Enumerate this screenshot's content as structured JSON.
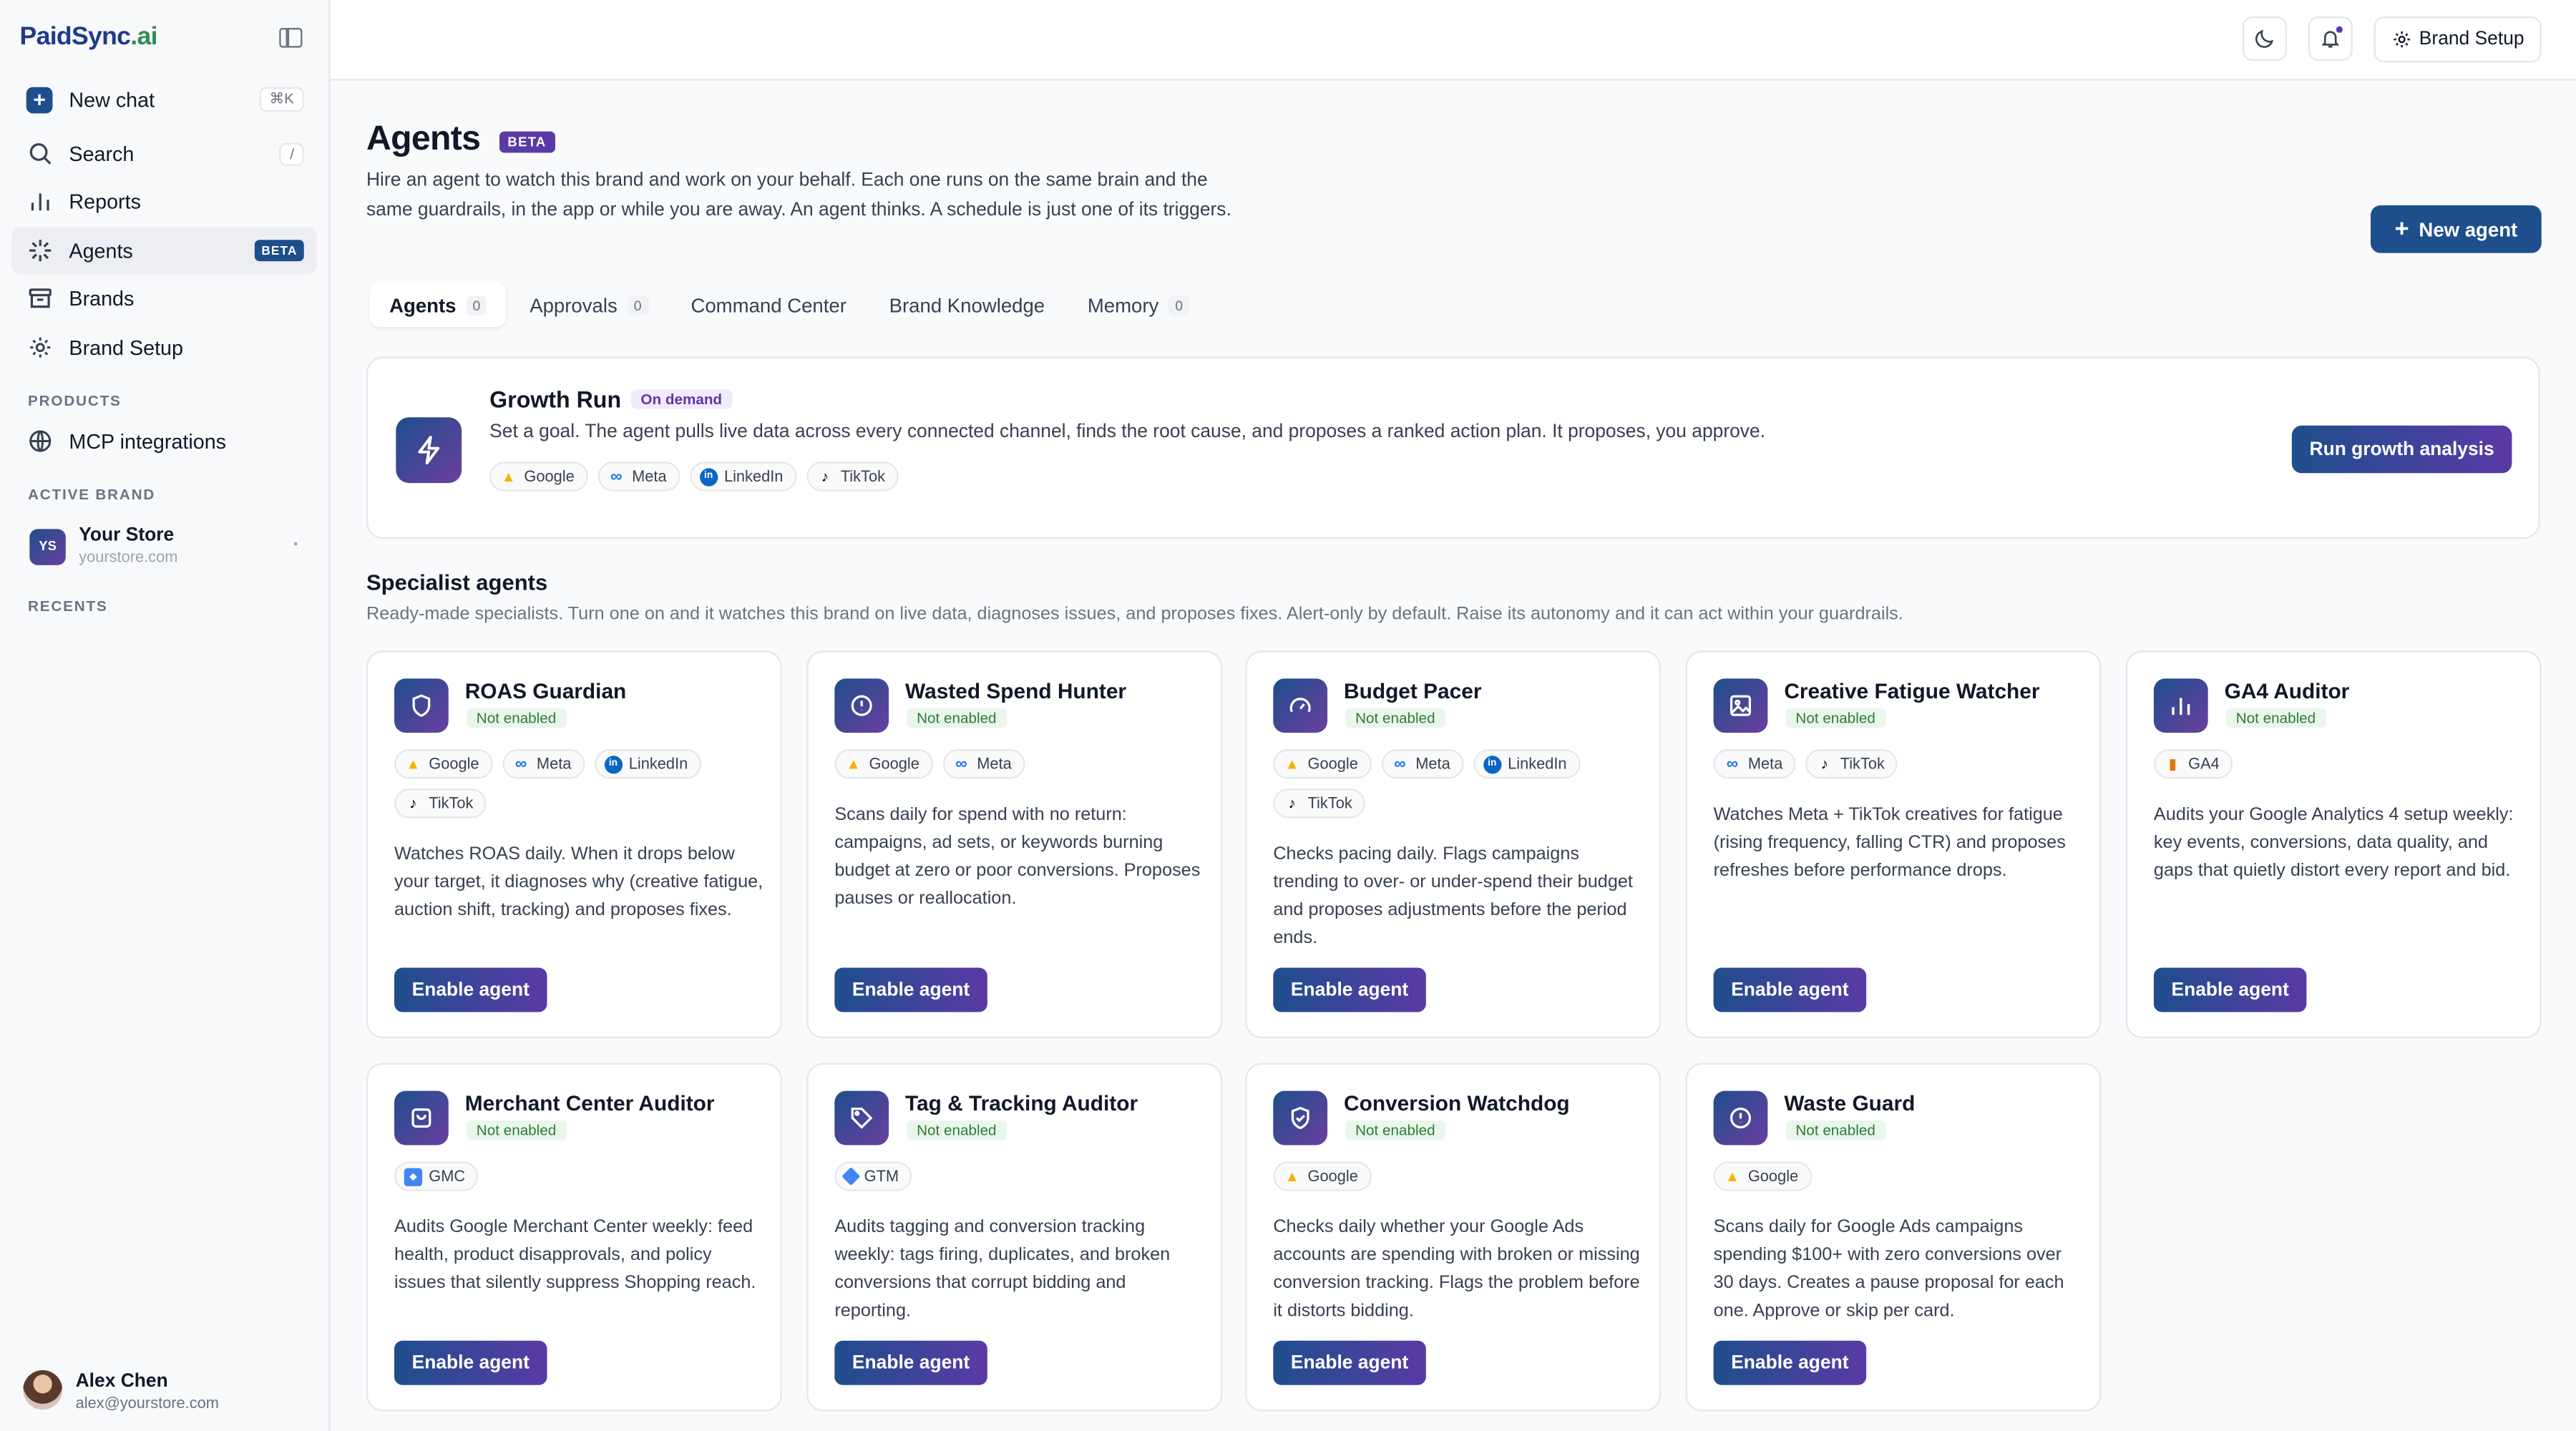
{
  "app": {
    "logo_part1": "PaidSync",
    "logo_part2": ".ai"
  },
  "sidebar": {
    "new_chat": {
      "label": "New chat",
      "shortcut": "⌘K"
    },
    "search": {
      "label": "Search",
      "shortcut": "/"
    },
    "reports": {
      "label": "Reports"
    },
    "agents": {
      "label": "Agents",
      "badge": "BETA"
    },
    "brands": {
      "label": "Brands"
    },
    "brand_setup": {
      "label": "Brand Setup"
    },
    "products_label": "PRODUCTS",
    "mcp": {
      "label": "MCP integrations"
    },
    "active_brand_label": "ACTIVE BRAND",
    "brand": {
      "initials": "YS",
      "name": "Your Store",
      "url": "yourstore.com"
    },
    "recents_label": "RECENTS",
    "user": {
      "name": "Alex Chen",
      "email": "alex@yourstore.com"
    }
  },
  "topbar": {
    "brand_setup_label": "Brand Setup"
  },
  "header": {
    "title": "Agents",
    "badge": "BETA",
    "description": "Hire an agent to watch this brand and work on your behalf. Each one runs on the same brain and the same guardrails, in the app or while you are away. An agent thinks. A schedule is just one of its triggers.",
    "new_agent_label": "New agent"
  },
  "tabs": [
    {
      "label": "Agents",
      "count": "0"
    },
    {
      "label": "Approvals",
      "count": "0"
    },
    {
      "label": "Command Center"
    },
    {
      "label": "Brand Knowledge"
    },
    {
      "label": "Memory",
      "count": "0"
    }
  ],
  "growth_run": {
    "title": "Growth Run",
    "badge": "On demand",
    "description": "Set a goal. The agent pulls live data across every connected channel, finds the root cause, and proposes a ranked action plan. It proposes, you approve.",
    "channels": [
      "Google",
      "Meta",
      "LinkedIn",
      "TikTok"
    ],
    "button": "Run growth analysis"
  },
  "specialists": {
    "title": "Specialist agents",
    "description": "Ready-made specialists. Turn one on and it watches this brand on live data, diagnoses issues, and proposes fixes. Alert-only by default. Raise its autonomy and it can act within your guardrails.",
    "status_label": "Not enabled",
    "button_label": "Enable agent",
    "agents": [
      {
        "name": "ROAS Guardian",
        "icon": "shield-icon",
        "channels": [
          "Google",
          "Meta",
          "LinkedIn",
          "TikTok"
        ],
        "description": "Watches ROAS daily. When it drops below your target, it diagnoses why (creative fatigue, auction shift, tracking) and proposes fixes."
      },
      {
        "name": "Wasted Spend Hunter",
        "icon": "alert-circle-icon",
        "channels": [
          "Google",
          "Meta"
        ],
        "description": "Scans daily for spend with no return: campaigns, ad sets, or keywords burning budget at zero or poor conversions. Proposes pauses or reallocation."
      },
      {
        "name": "Budget Pacer",
        "icon": "gauge-icon",
        "channels": [
          "Google",
          "Meta",
          "LinkedIn",
          "TikTok"
        ],
        "description": "Checks pacing daily. Flags campaigns trending to over- or under-spend their budget and proposes adjustments before the period ends."
      },
      {
        "name": "Creative Fatigue Watcher",
        "icon": "image-icon",
        "channels": [
          "Meta",
          "TikTok"
        ],
        "description": "Watches Meta + TikTok creatives for fatigue (rising frequency, falling CTR) and proposes refreshes before performance drops."
      },
      {
        "name": "GA4 Auditor",
        "icon": "bar-chart-icon",
        "channels": [
          "GA4"
        ],
        "description": "Audits your Google Analytics 4 setup weekly: key events, conversions, data quality, and gaps that quietly distort every report and bid."
      },
      {
        "name": "Merchant Center Auditor",
        "icon": "shopping-bag-icon",
        "channels": [
          "GMC"
        ],
        "description": "Audits Google Merchant Center weekly: feed health, product disapprovals, and policy issues that silently suppress Shopping reach."
      },
      {
        "name": "Tag & Tracking Auditor",
        "icon": "tag-icon",
        "channels": [
          "GTM"
        ],
        "description": "Audits tagging and conversion tracking weekly: tags firing, duplicates, and broken conversions that corrupt bidding and reporting."
      },
      {
        "name": "Conversion Watchdog",
        "icon": "shield-check-icon",
        "channels": [
          "Google"
        ],
        "description": "Checks daily whether your Google Ads accounts are spending with broken or missing conversion tracking. Flags the problem before it distorts bidding."
      },
      {
        "name": "Waste Guard",
        "icon": "alert-circle-icon",
        "channels": [
          "Google"
        ],
        "description": "Scans daily for Google Ads campaigns spending $100+ with zero conversions over 30 days. Creates a pause proposal for each one. Approve or skip per card."
      }
    ]
  }
}
